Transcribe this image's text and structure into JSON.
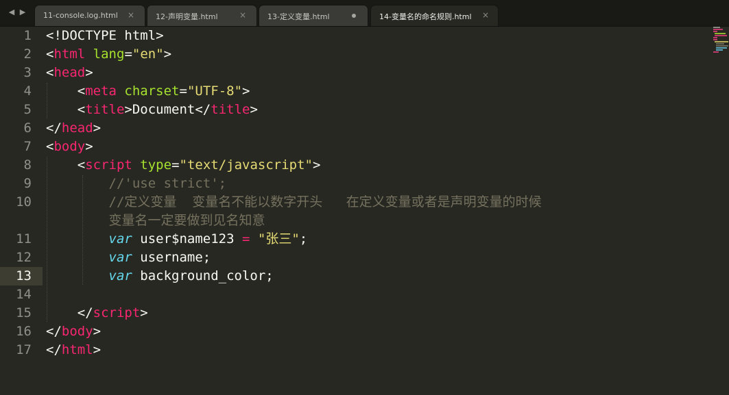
{
  "tabbar": {
    "back_icon": "◀",
    "forward_icon": "▶",
    "tabs": [
      {
        "label": "11-console.log.html",
        "close": "×",
        "active": false,
        "modified": false
      },
      {
        "label": "12-声明变量.html",
        "close": "×",
        "active": false,
        "modified": false
      },
      {
        "label": "13-定义变量.html",
        "close": "",
        "active": false,
        "modified": true
      },
      {
        "label": "14-变量名的命名规则.html",
        "close": "×",
        "active": true,
        "modified": false
      }
    ]
  },
  "editor": {
    "current_line": "13",
    "line_numbers": [
      "1",
      "2",
      "3",
      "4",
      "5",
      "6",
      "7",
      "8",
      "9",
      "10",
      "",
      "11",
      "12",
      "13",
      "14",
      "15",
      "16",
      "17"
    ],
    "code": {
      "l1": {
        "a": "<!DOCTYPE html>"
      },
      "l2": {
        "a": "<",
        "b": "html",
        "c": " ",
        "d": "lang",
        "e": "=",
        "f": "\"en\"",
        "g": ">"
      },
      "l3": {
        "a": "<",
        "b": "head",
        "c": ">"
      },
      "l4": {
        "a": "    <",
        "b": "meta",
        "c": " ",
        "d": "charset",
        "e": "=",
        "f": "\"UTF-8\"",
        "g": ">"
      },
      "l5": {
        "a": "    <",
        "b": "title",
        "c": ">Document</",
        "d": "title",
        "e": ">"
      },
      "l6": {
        "a": "</",
        "b": "head",
        "c": ">"
      },
      "l7": {
        "a": "<",
        "b": "body",
        "c": ">"
      },
      "l8": {
        "a": "    <",
        "b": "script",
        "c": " ",
        "d": "type",
        "e": "=",
        "f": "\"text/javascript\"",
        "g": ">"
      },
      "l9": {
        "a": "        ",
        "b": "//'use strict';"
      },
      "l10": {
        "a": "        ",
        "b": "//定义变量  变量名不能以数字开头   在定义变量或者是声明变量的时候"
      },
      "l10b": {
        "a": "        ",
        "b": "变量名一定要做到见名知意"
      },
      "l11": {
        "a": "        ",
        "b": "var",
        "c": " user$name123 ",
        "d": "=",
        "e": " ",
        "f": "\"张三\"",
        "g": ";"
      },
      "l12": {
        "a": "        ",
        "b": "var",
        "c": " username;"
      },
      "l13": {
        "a": "        ",
        "b": "var",
        "c": " background_color;"
      },
      "l14": {
        "a": ""
      },
      "l15": {
        "a": "    </",
        "b": "script",
        "c": ">"
      },
      "l16": {
        "a": "</",
        "b": "body",
        "c": ">"
      },
      "l17": {
        "a": "</",
        "b": "html",
        "c": ">"
      }
    }
  },
  "colors": {
    "background": "#272822",
    "tag": "#f92672",
    "attribute": "#a6e22e",
    "string": "#e6db74",
    "comment": "#75715e",
    "storage_keyword": "#66d9ef",
    "text": "#f8f8f2"
  }
}
